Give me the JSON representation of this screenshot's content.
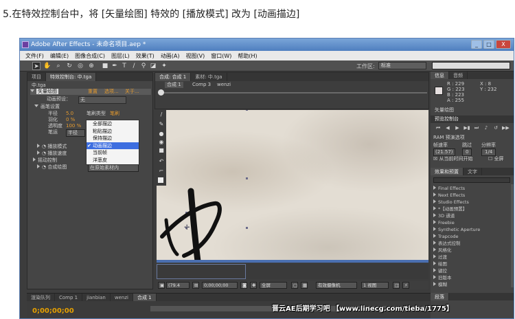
{
  "heading": "5.在特效控制台中，将 [矢量绘图] 特效的 [播放模式] 改为 [动画描边]",
  "window": {
    "title": "Adobe After Effects - 未命名项目.aep *",
    "min": "_",
    "max": "□",
    "close": "X"
  },
  "menu": [
    "文件(F)",
    "编辑(E)",
    "图像合成(C)",
    "图层(L)",
    "效果(T)",
    "动画(A)",
    "视图(V)",
    "窗口(W)",
    "帮助(H)"
  ],
  "toolbar": {
    "workspace_label": "工作区:",
    "workspace_value": "标准"
  },
  "effects_panel": {
    "tabs": [
      "项目",
      "特效控制台: 中.tga"
    ],
    "layer_name": "中.tga",
    "effect_name": "矢量绘图",
    "reset": "重置",
    "options": "选项...",
    "about": "关于...",
    "anim_preset_label": "动画预设：",
    "anim_preset_value": "无",
    "brush_settings": "画笔设置",
    "radius_label": "半径",
    "radius_value": "5.0",
    "feather_label": "羽化",
    "feather_value": "0 %",
    "opacity_label": "透明度",
    "opacity_value": "100 %",
    "brush_type_label": "笔刷类型",
    "brush_type_value": "笔刷",
    "stroke_label": "笔运",
    "stroke_value": "半径",
    "playback_mode": "播放模式",
    "playback_speed": "播放速度",
    "wiggle": "摇动控制",
    "composite": "合成绘图",
    "composite_value": "在原始素材内"
  },
  "dropdown": {
    "items": [
      "全部描边",
      "粘贴描边",
      "保持描边",
      "动画描边",
      "当前帧",
      "洋葱皮"
    ],
    "selected_index": 3
  },
  "viewer": {
    "tabs": [
      "合成: 合成 1",
      "素材: 中.tga"
    ],
    "breadcrumbs": [
      "合成 1",
      "Comp 3",
      "wenzi"
    ],
    "zoom": "(79.4",
    "timecode": "0;00;00;00",
    "resolution": "全屏",
    "camera": "有效摄像机",
    "views": "1 视图"
  },
  "info_panel": {
    "tabs": [
      "信息",
      "音频"
    ],
    "r": "R : 229",
    "g": "G : 223",
    "b": "B : 223",
    "a": "A : 255",
    "x": "X : 8",
    "y": "Y : 232",
    "layer": "矢量绘图",
    "swatch_color": "#e5dfdf"
  },
  "preview_panel": {
    "title": "预览控制台",
    "ram": "RAM 预演选项",
    "frame_rate_label": "帧速率",
    "skip_label": "跳过",
    "resolution_label": "分辨率",
    "frame_rate_value": "(21.57)",
    "skip_value": "0",
    "resolution_value": "1/4",
    "from_current": "从当前时间开始",
    "full_screen": "全屏"
  },
  "effects_presets": {
    "tabs": [
      "效果和预置",
      "文字"
    ],
    "items": [
      "Final Effects",
      "Next Effects",
      "Studio Effects",
      "*【动画预置】",
      "3D 通道",
      "Freebie",
      "Synthetic Aperture",
      "Trapcode",
      "表达式控制",
      "风格化",
      "过渡",
      "绘图",
      "键控",
      "旧版本",
      "模糊"
    ]
  },
  "timeline": {
    "tabs": [
      "渲染队列",
      "Comp 1",
      "jianbian",
      "wenzi",
      "合成 1"
    ],
    "timecode": "0;00;00;00"
  },
  "para_label": "段落",
  "watermark": "晋云AE后期学习吧 【www.linecg.com/tieba/1775】"
}
